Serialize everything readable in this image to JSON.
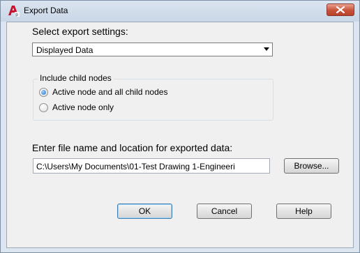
{
  "window": {
    "title": "Export Data",
    "icons": {
      "app": "autocad-app-icon",
      "close": "close-icon"
    }
  },
  "settings": {
    "heading": "Select export settings:",
    "selected_option": "Displayed Data"
  },
  "child_nodes": {
    "group_label": "Include child nodes",
    "options": [
      {
        "label": "Active node and all child nodes",
        "selected": true
      },
      {
        "label": "Active node only",
        "selected": false
      }
    ]
  },
  "file": {
    "label": "Enter file name and location for exported data:",
    "path": "C:\\Users\\My Documents\\01-Test Drawing 1-Engineeri",
    "browse_label": "Browse..."
  },
  "buttons": {
    "ok": "OK",
    "cancel": "Cancel",
    "help": "Help"
  },
  "colors": {
    "close_button": "#c9533a",
    "app_icon": "#c8102e",
    "radio_selected": "#1d6fc6"
  }
}
